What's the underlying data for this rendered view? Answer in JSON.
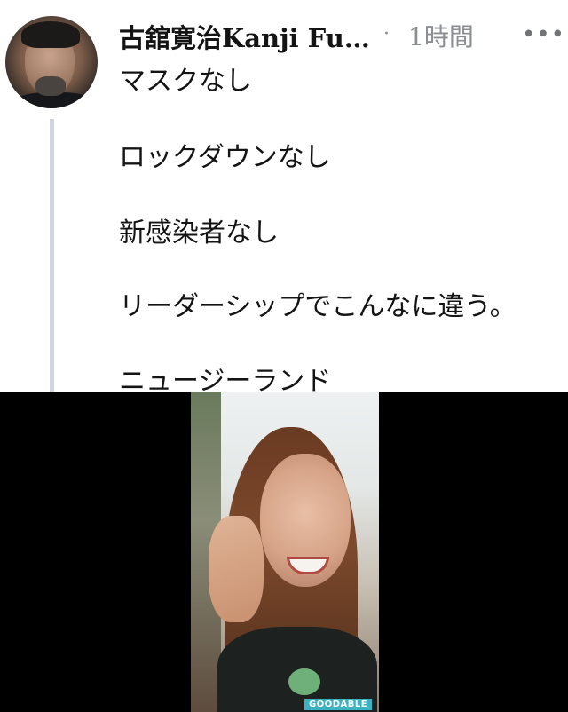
{
  "tweet": {
    "author_name": "古舘寛治Kanji Fu…",
    "separator": "·",
    "timestamp": "1時間",
    "more_icon": "more-horizontal-icon",
    "lines": [
      "マスクなし",
      "ロックダウンなし",
      "新感染者なし",
      "リーダーシップでこんなに違う。",
      "ニュージーランド"
    ]
  },
  "media": {
    "watermark": "GOODABLE"
  },
  "colors": {
    "text": "#141414",
    "meta": "#8a8f94",
    "thread_line": "#cfd5dc",
    "watermark_bg": "#3bb3c2"
  }
}
